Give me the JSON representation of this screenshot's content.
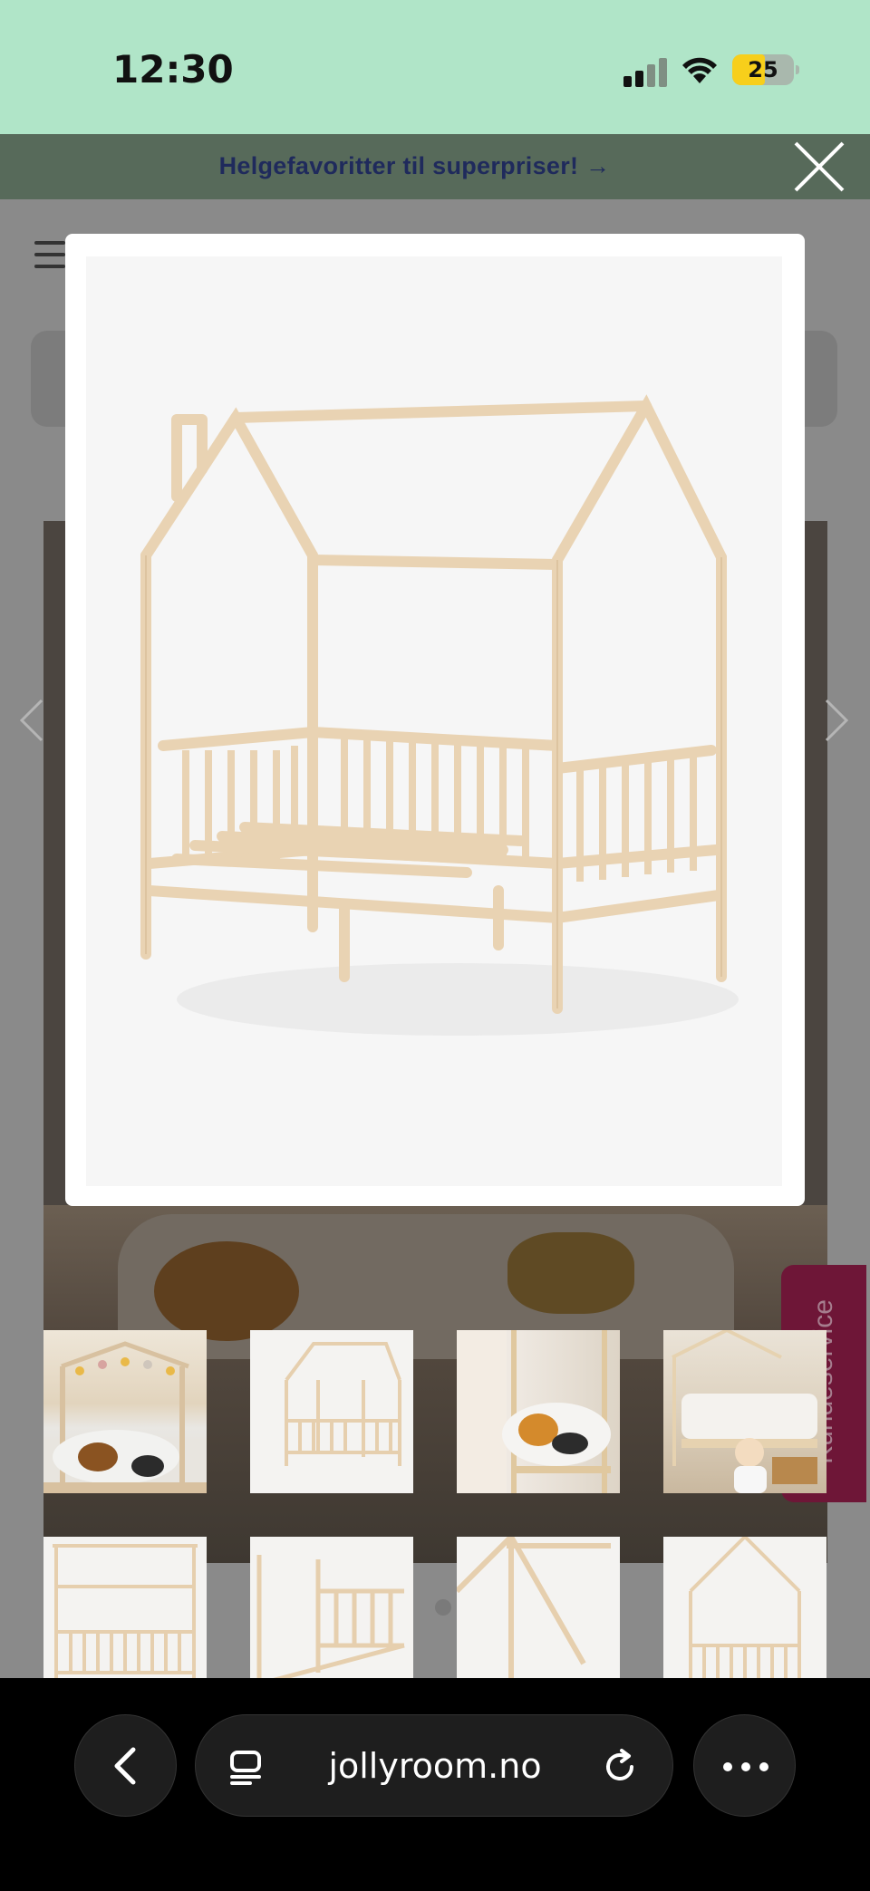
{
  "status_bar": {
    "time": "12:30",
    "battery": "25"
  },
  "promo": {
    "text": "Helgefavoritter til superpriser! →"
  },
  "page": {
    "side_tab": "Kundeservice"
  },
  "browser": {
    "url": "jollyroom.no"
  },
  "icons": {
    "close": "close-icon",
    "back": "chevron-left-icon",
    "tabs": "tab-overview-icon",
    "reload": "reload-icon",
    "more": "more-icon",
    "menu": "hamburger-icon",
    "prev": "chevron-left-icon",
    "next": "chevron-right-icon"
  },
  "colors": {
    "status_bar": "#b0e5c8",
    "promo_bg": "#576a5a",
    "promo_text": "#1f2a5c",
    "side_tab": "#6e1637",
    "wood": "#e6cfae"
  }
}
